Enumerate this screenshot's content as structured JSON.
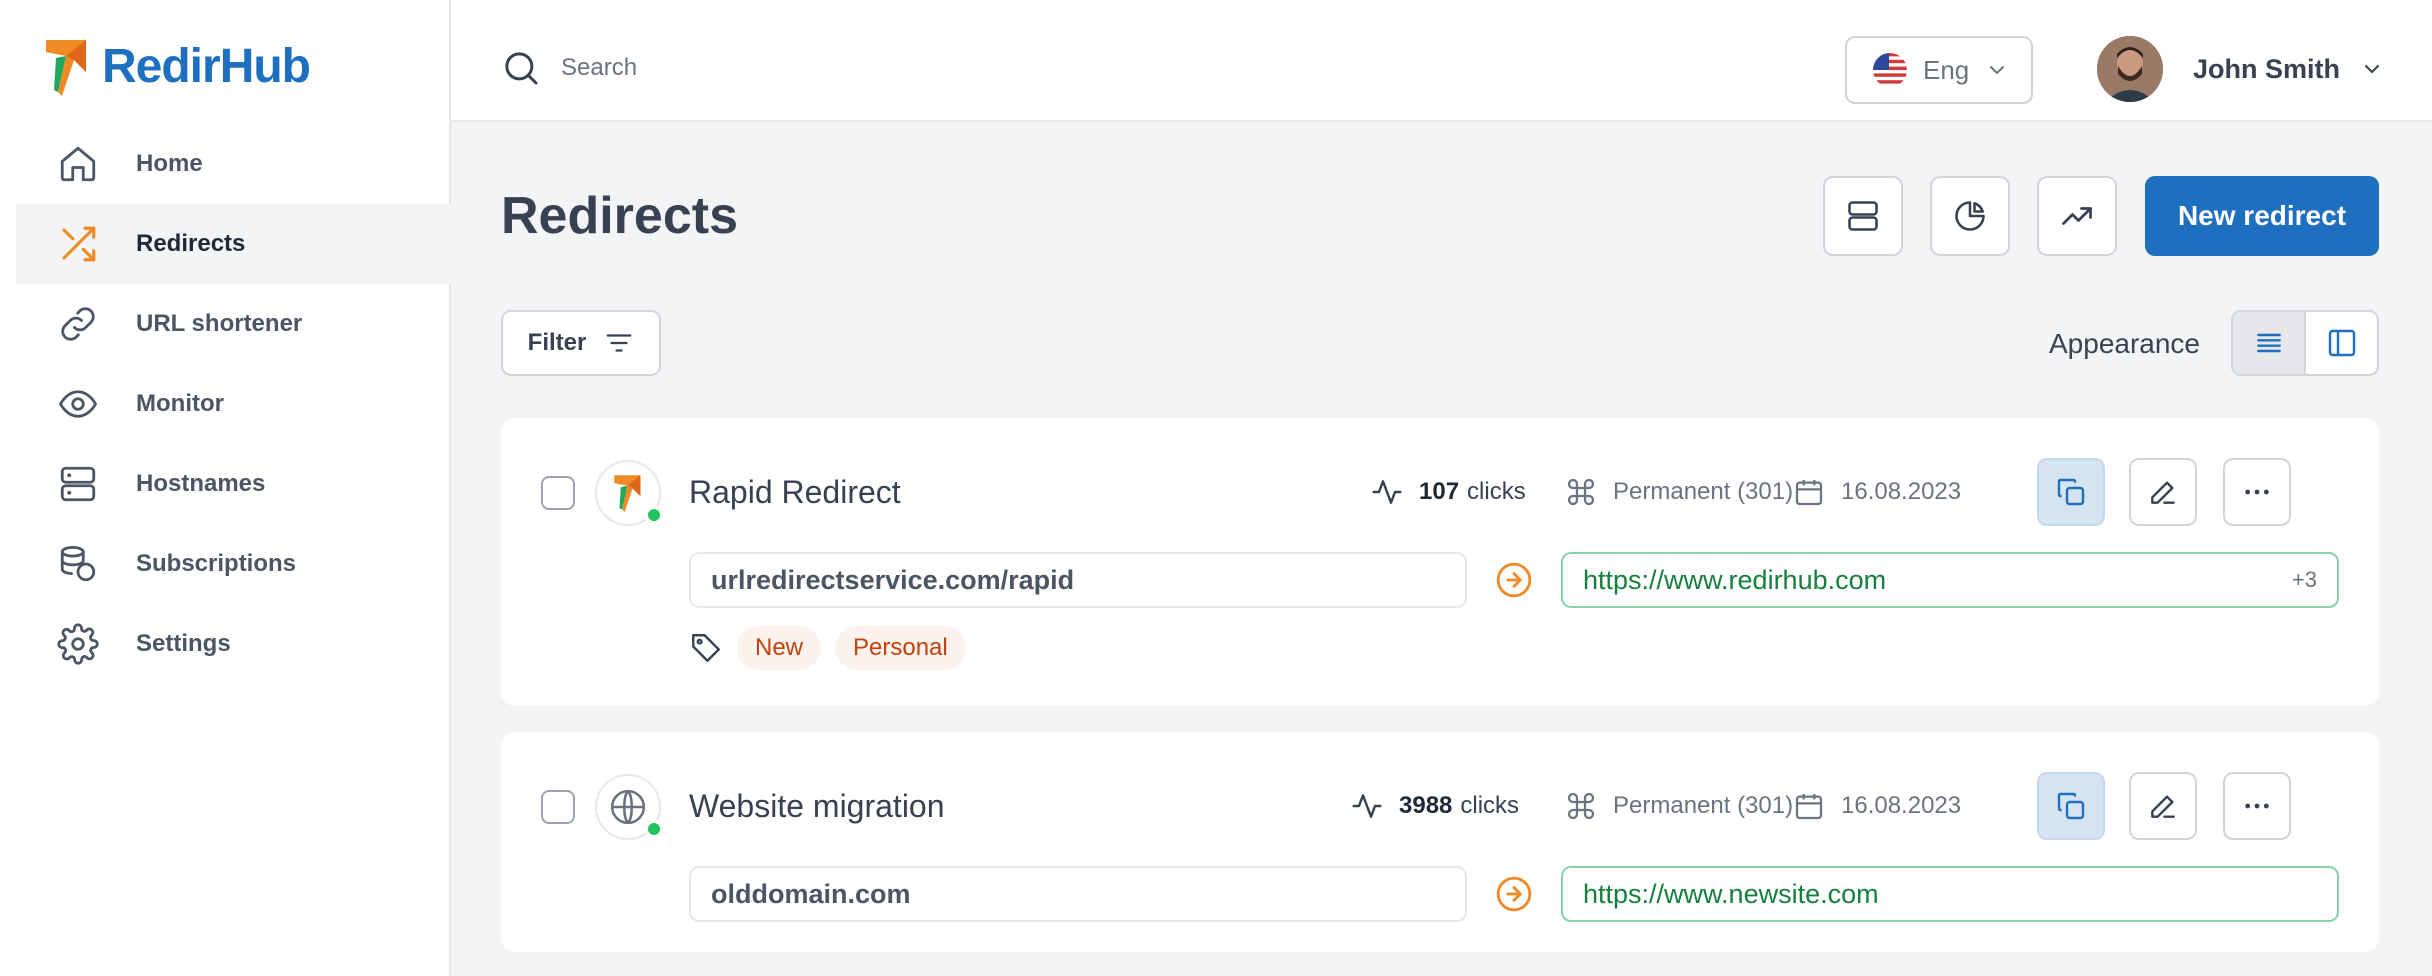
{
  "brand": {
    "name": "RedirHub"
  },
  "sidebar": {
    "items": [
      {
        "label": "Home",
        "icon": "home-icon"
      },
      {
        "label": "Redirects",
        "icon": "shuffle-icon",
        "active": true
      },
      {
        "label": "URL shortener",
        "icon": "link-icon"
      },
      {
        "label": "Monitor",
        "icon": "eye-icon"
      },
      {
        "label": "Hostnames",
        "icon": "server-icon"
      },
      {
        "label": "Subscriptions",
        "icon": "coins-icon"
      },
      {
        "label": "Settings",
        "icon": "gear-icon"
      }
    ]
  },
  "topbar": {
    "search_placeholder": "Search",
    "language": "Eng",
    "user_name": "John Smith"
  },
  "page": {
    "title": "Redirects",
    "new_button": "New redirect",
    "filter_label": "Filter",
    "appearance_label": "Appearance"
  },
  "redirects": [
    {
      "name": "Rapid Redirect",
      "clicks_count": "107",
      "clicks_label": "clicks",
      "type": "Permanent (301)",
      "date": "16.08.2023",
      "source": "urlredirectservice.com/rapid",
      "destination": "https://www.redirhub.com",
      "extra": "+3",
      "tags": [
        "New",
        "Personal"
      ]
    },
    {
      "name": "Website migration",
      "clicks_count": "3988",
      "clicks_label": "clicks",
      "type": "Permanent (301)",
      "date": "16.08.2023",
      "source": "olddomain.com",
      "destination": "https://www.newsite.com"
    }
  ],
  "colors": {
    "accent": "#1f6fc0",
    "orange": "#f08a24",
    "status_green": "#22c55e",
    "destination_green": "#15803d"
  }
}
